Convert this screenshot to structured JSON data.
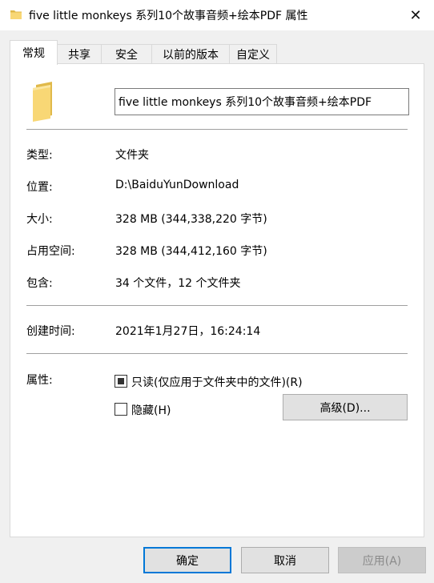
{
  "window": {
    "title": "five little monkeys 系列10个故事音频+绘本PDF 属性",
    "close_glyph": "✕",
    "icon": "folder-icon"
  },
  "tabs": [
    {
      "label": "常规",
      "active": true
    },
    {
      "label": "共享",
      "active": false
    },
    {
      "label": "安全",
      "active": false
    },
    {
      "label": "以前的版本",
      "active": false
    },
    {
      "label": "自定义",
      "active": false
    }
  ],
  "general": {
    "folder_name": "five little monkeys 系列10个故事音频+绘本PDF",
    "rows": [
      {
        "label": "类型:",
        "value": "文件夹"
      },
      {
        "label": "位置:",
        "value": "D:\\BaiduYunDownload"
      },
      {
        "label": "大小:",
        "value": "328 MB (344,338,220 字节)"
      },
      {
        "label": "占用空间:",
        "value": "328 MB (344,412,160 字节)"
      },
      {
        "label": "包含:",
        "value": "34 个文件，12 个文件夹"
      }
    ],
    "created": {
      "label": "创建时间:",
      "value": "2021年1月27日，16:24:14"
    },
    "attributes": {
      "label": "属性:",
      "readonly_label": "只读(仅应用于文件夹中的文件)(R)",
      "readonly_state": "indeterminate",
      "hidden_label": "隐藏(H)",
      "hidden_checked": false,
      "advanced_label": "高级(D)..."
    }
  },
  "buttons": {
    "ok": "确定",
    "cancel": "取消",
    "apply": "应用(A)"
  },
  "colors": {
    "folder_yellow": "#f8d775",
    "folder_dark": "#e0b94a",
    "focus_blue": "#0078d7"
  }
}
